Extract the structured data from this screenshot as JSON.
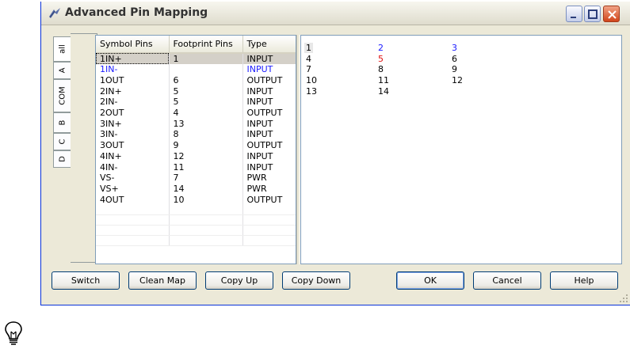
{
  "window": {
    "title": "Advanced Pin Mapping"
  },
  "tabs": [
    "all",
    "A",
    "COM",
    "B",
    "C",
    "D"
  ],
  "table": {
    "columns": [
      "Symbol Pins",
      "Footprint Pins",
      "Type"
    ],
    "rows": [
      [
        "1IN+",
        "1",
        "INPUT"
      ],
      [
        "1IN-",
        "",
        "INPUT"
      ],
      [
        "1OUT",
        "6",
        "OUTPUT"
      ],
      [
        "2IN+",
        "5",
        "INPUT"
      ],
      [
        "2IN-",
        "5",
        "INPUT"
      ],
      [
        "2OUT",
        "4",
        "OUTPUT"
      ],
      [
        "3IN+",
        "13",
        "INPUT"
      ],
      [
        "3IN-",
        "8",
        "INPUT"
      ],
      [
        "3OUT",
        "9",
        "OUTPUT"
      ],
      [
        "4IN+",
        "12",
        "INPUT"
      ],
      [
        "4IN-",
        "11",
        "INPUT"
      ],
      [
        "VS-",
        "7",
        "PWR"
      ],
      [
        "VS+",
        "14",
        "PWR"
      ],
      [
        "4OUT",
        "10",
        "OUTPUT"
      ]
    ]
  },
  "pins": {
    "grid": [
      [
        "1",
        "2",
        "3"
      ],
      [
        "4",
        "5",
        "6"
      ],
      [
        "7",
        "8",
        "9"
      ],
      [
        "10",
        "11",
        "12"
      ],
      [
        "13",
        "14",
        ""
      ]
    ],
    "blue": [
      "2",
      "3"
    ],
    "red": [
      "5"
    ],
    "selected": "1"
  },
  "buttons": {
    "switch": "Switch",
    "clean_map": "Clean Map",
    "copy_up": "Copy Up",
    "copy_down": "Copy Down",
    "ok": "OK",
    "cancel": "Cancel",
    "help": "Help"
  },
  "colors": {
    "blue_text": "#1a1aff",
    "red_text": "#e01010",
    "selection": "#d4d0c8"
  },
  "icons": {
    "title": "pin-mapping-icon",
    "hint": "lightbulb-icon"
  }
}
